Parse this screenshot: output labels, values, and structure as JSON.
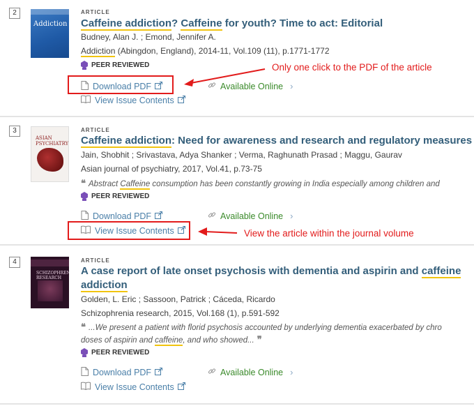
{
  "results": [
    {
      "number": "2",
      "type": "ARTICLE",
      "title_parts": [
        "Caffeine addiction",
        "? ",
        "Caffeine",
        " for youth? Time to act: Editorial"
      ],
      "authors": "Budney, Alan J. ; Emond, Jennifer A.",
      "source_parts": [
        "Addiction",
        " (Abingdon, England), 2014-11, Vol.109 (11), p.1771-1772"
      ],
      "peer_reviewed": "PEER REVIEWED",
      "pdf_label": "Download PDF",
      "availability": "Available Online",
      "issue_label": "View Issue Contents",
      "cover_title": "Addiction"
    },
    {
      "number": "3",
      "type": "ARTICLE",
      "title_parts": [
        "Caffeine addiction",
        ": Need for awareness and research and regulatory measures"
      ],
      "authors": "Jain, Shobhit ; Srivastava, Adya Shanker ; Verma, Raghunath Prasad ; Maggu, Gaurav",
      "source": "Asian journal of psychiatry, 2017, Vol.41, p.73-75",
      "abstract_parts": [
        "Abstract ",
        "Caffeine",
        " consumption has been constantly growing in India especially among children and"
      ],
      "peer_reviewed": "PEER REVIEWED",
      "pdf_label": "Download PDF",
      "availability": "Available Online",
      "issue_label": "View Issue Contents",
      "cover_title": "ASIAN PSYCHIATRY"
    },
    {
      "number": "4",
      "type": "ARTICLE",
      "title_parts": [
        "A case report of late onset psychosis with dementia and aspirin and ",
        "caffeine",
        " ",
        "addiction"
      ],
      "authors": "Golden, L. Eric ; Sassoon, Patrick ; Cáceda, Ricardo",
      "source": "Schizophrenia research, 2015, Vol.168 (1), p.591-592",
      "abstract_line1": "...We present a patient with florid psychosis accounted by underlying dementia exacerbated by chro",
      "abstract_line2_parts": [
        "doses of aspirin and ",
        "caffeine",
        ", and who showed..."
      ],
      "peer_reviewed": "PEER REVIEWED",
      "pdf_label": "Download PDF",
      "availability": "Available Online",
      "issue_label": "View Issue Contents",
      "cover_title": "SCHIZOPHRENIA RESEARCH"
    }
  ],
  "annotations": {
    "pdf_note": "Only one click to the PDF of the article",
    "issue_note": "View the article within the journal volume"
  },
  "colors": {
    "title": "#335e7a",
    "link": "#4a7fa8",
    "available": "#3a8a2a",
    "highlight": "#f1c40f",
    "annotation": "#e21b1b",
    "peer_icon": "#7a4fb8"
  }
}
